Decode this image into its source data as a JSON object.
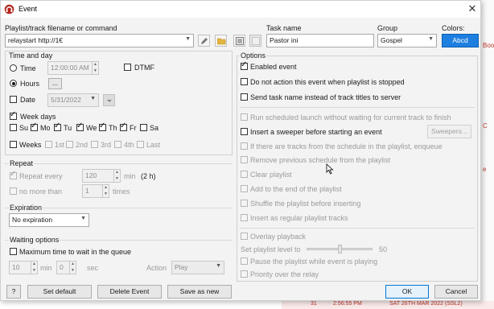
{
  "window": {
    "title": "Event"
  },
  "background": {
    "frag1": "Boo",
    "frag2": "C",
    "frag3": "e",
    "row_col1": "31",
    "row_col2": "2:56:55 PM",
    "row_col3": "SAT 26TH MAR 2022 (SSL2)"
  },
  "header": {
    "playlist_label": "Playlist/track filename or command",
    "playlist_value": "relaystart http://1€",
    "task_label": "Task name",
    "task_value": "Pastor ini",
    "group_label": "Group",
    "group_value": "Gospel",
    "colors_label": "Colors:",
    "colors_value": "Abcd"
  },
  "time_and_day": {
    "legend": "Time and day",
    "time_label": "Time",
    "time_value": "12:00:00 AM",
    "dtmf_label": "DTMF",
    "hours_label": "Hours",
    "hours_btn": "...",
    "date_label": "Date",
    "date_value": "5/31/2022",
    "week_days_label": "Week days",
    "days": [
      "Su",
      "Mo",
      "Tu",
      "We",
      "Th",
      "Fr",
      "Sa"
    ],
    "weeks_label": "Weeks",
    "weeks": [
      "1st",
      "2nd",
      "3rd",
      "4th",
      "Last"
    ]
  },
  "repeat": {
    "legend": "Repeat",
    "repeat_every_label": "Repeat every",
    "repeat_value": "120",
    "min_label": "min",
    "hours_note": "(2 h)",
    "no_more_label": "no more than",
    "times_value": "1",
    "times_label": "times"
  },
  "expiration": {
    "legend": "Expiration",
    "value": "No expiration"
  },
  "waiting": {
    "legend": "Waiting options",
    "max_wait_label": "Maximum time to wait in the queue",
    "min_value": "10",
    "min_label": "min",
    "sec_value": "0",
    "sec_label": "sec",
    "action_label": "Action",
    "action_value": "Play"
  },
  "options": {
    "legend": "Options",
    "enabled": "Enabled event",
    "no_action": "Do not action this event when playlist is stopped",
    "send_task": "Send task name instead of track titles to server",
    "run_scheduled": "Run scheduled launch without waiting for current track to finish",
    "insert_sweeper": "Insert a sweeper before starting an event",
    "sweepers_btn": "Sweepers...",
    "if_tracks": "If there are tracks from the schedule in the playlist, enqueue",
    "remove_prev": "Remove previous schedule from the playlist",
    "clear_playlist": "Clear playlist",
    "add_to_end": "Add to the end of the playlist",
    "shuffle": "Shuffle the playlist before inserting",
    "insert_regular": "Insert as regular playlist tracks",
    "overlay": "Overlay playback",
    "set_level": "Set playlist level to",
    "level_value": "50",
    "level_fraction": 0.5,
    "pause_playlist": "Pause the playlist while event is playing",
    "priority": "Priority over the relay"
  },
  "footer": {
    "help": "?",
    "set_default": "Set default",
    "delete_event": "Delete Event",
    "save_as_new": "Save as new",
    "ok": "OK",
    "cancel": "Cancel"
  },
  "colors": {
    "accent": "#0078d7",
    "colors_swatch": "#1e7fe0"
  }
}
